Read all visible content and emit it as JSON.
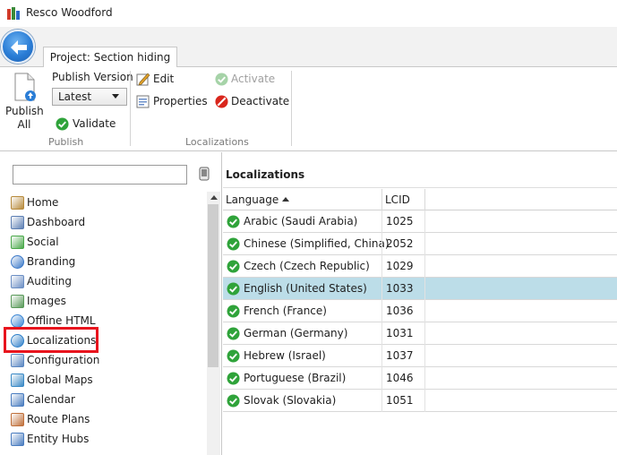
{
  "window": {
    "title": "Resco Woodford"
  },
  "ribbon": {
    "project_tab": "Project: Section hiding",
    "publish_all_line1": "Publish",
    "publish_all_line2": "All",
    "publish_version_label": "Publish Version",
    "publish_version_value": "Latest",
    "validate_label": "Validate",
    "publish_group_label": "Publish",
    "edit_label": "Edit",
    "properties_label": "Properties",
    "activate_label": "Activate",
    "deactivate_label": "Deactivate",
    "localizations_group_label": "Localizations"
  },
  "search": {
    "placeholder": "",
    "value": ""
  },
  "nav": {
    "items": [
      {
        "label": "Home",
        "icon": "home-icon",
        "color": "#b78a3b"
      },
      {
        "label": "Dashboard",
        "icon": "dashboard-icon",
        "color": "#5d7fb3"
      },
      {
        "label": "Social",
        "icon": "social-icon",
        "color": "#4aa84a"
      },
      {
        "label": "Branding",
        "icon": "branding-icon",
        "color": "#3a78c8"
      },
      {
        "label": "Auditing",
        "icon": "auditing-icon",
        "color": "#6c8fc4"
      },
      {
        "label": "Images",
        "icon": "images-icon",
        "color": "#5a9a5a"
      },
      {
        "label": "Offline HTML",
        "icon": "offline-html-icon",
        "color": "#3b86d4"
      },
      {
        "label": "Localizations",
        "icon": "globe-icon",
        "color": "#2f7fc9"
      },
      {
        "label": "Configuration",
        "icon": "gear-icon",
        "color": "#5b87c2"
      },
      {
        "label": "Global Maps",
        "icon": "global-maps-icon",
        "color": "#3b8ac6"
      },
      {
        "label": "Calendar",
        "icon": "calendar-icon",
        "color": "#4a7dc0"
      },
      {
        "label": "Route Plans",
        "icon": "route-plans-icon",
        "color": "#c0703b"
      },
      {
        "label": "Entity Hubs",
        "icon": "entity-hubs-icon",
        "color": "#4a7dc0"
      }
    ]
  },
  "panel": {
    "title": "Localizations",
    "col_language": "Language",
    "col_lcid": "LCID",
    "rows": [
      {
        "language": "Arabic (Saudi Arabia)",
        "lcid": "1025"
      },
      {
        "language": "Chinese (Simplified, China)",
        "lcid": "2052"
      },
      {
        "language": "Czech (Czech Republic)",
        "lcid": "1029"
      },
      {
        "language": "English (United States)",
        "lcid": "1033"
      },
      {
        "language": "French (France)",
        "lcid": "1036"
      },
      {
        "language": "German (Germany)",
        "lcid": "1031"
      },
      {
        "language": "Hebrew (Israel)",
        "lcid": "1037"
      },
      {
        "language": "Portuguese (Brazil)",
        "lcid": "1046"
      },
      {
        "language": "Slovak (Slovakia)",
        "lcid": "1051"
      }
    ],
    "selected_row": 3
  },
  "colors": {
    "accent": "#2a7dd6",
    "selection": "#bcdde8",
    "highlight_box": "#e8141d",
    "check_green": "#2fa33a"
  }
}
